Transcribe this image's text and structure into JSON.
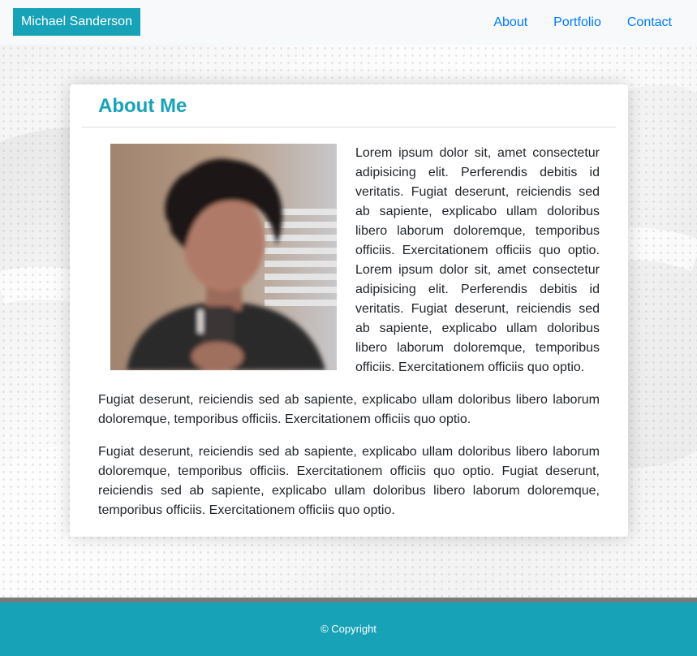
{
  "navbar": {
    "brand": "Michael Sanderson",
    "links": [
      "About",
      "Portfolio",
      "Contact"
    ]
  },
  "card": {
    "title": "About Me",
    "photo_alt": "profile-photo",
    "paragraphs": [
      "Lorem ipsum dolor sit, amet consectetur adipisicing elit. Perferendis debitis id veritatis. Fugiat deserunt, reiciendis sed ab sapiente, explicabo ullam doloribus libero laborum doloremque, temporibus officiis. Exercitationem officiis quo optio. Lorem ipsum dolor sit, amet consectetur adipisicing elit. Perferendis debitis id veritatis. Fugiat deserunt, reiciendis sed ab sapiente, explicabo ullam doloribus libero laborum doloremque, temporibus officiis. Exercitationem officiis quo optio.",
      "Fugiat deserunt, reiciendis sed ab sapiente, explicabo ullam doloribus libero laborum doloremque, temporibus officiis. Exercitationem officiis quo optio.",
      "Fugiat deserunt, reiciendis sed ab sapiente, explicabo ullam doloribus libero laborum doloremque, temporibus officiis. Exercitationem officiis quo optio. Fugiat deserunt, reiciendis sed ab sapiente, explicabo ullam doloribus libero laborum doloremque, temporibus officiis. Exercitationem officiis quo optio."
    ]
  },
  "footer": {
    "copyright": "© Copyright"
  },
  "colors": {
    "accent": "#17a2b8",
    "link": "#007bff",
    "navbar_bg": "#f8f9fa",
    "text": "#212529"
  }
}
